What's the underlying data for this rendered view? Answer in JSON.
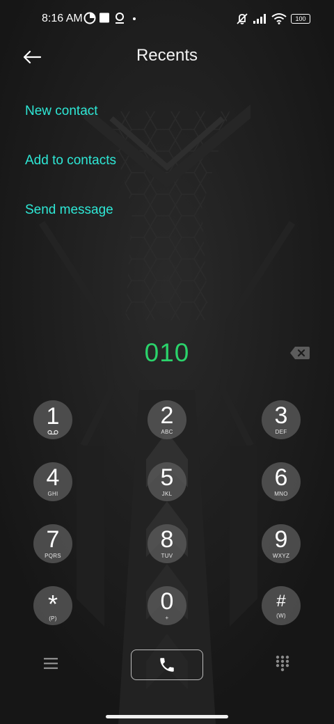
{
  "status_bar": {
    "time": "8:16 AM",
    "battery": "100",
    "left_icons": [
      "data-saver-icon",
      "square-notification-icon",
      "location-pin-icon",
      "dot-icon"
    ],
    "right_icons": [
      "muted-vibrate-icon",
      "signal-icon",
      "wifi-icon",
      "battery-icon"
    ]
  },
  "header": {
    "title": "Recents",
    "back_icon": "arrow-left-icon"
  },
  "actions": [
    {
      "label": "New contact"
    },
    {
      "label": "Add to contacts"
    },
    {
      "label": "Send message"
    }
  ],
  "dialer": {
    "number": "010",
    "backspace_icon": "backspace-icon",
    "keys": [
      {
        "digit": "1",
        "letters": "voicemail"
      },
      {
        "digit": "2",
        "letters": "ABC"
      },
      {
        "digit": "3",
        "letters": "DEF"
      },
      {
        "digit": "4",
        "letters": "GHI"
      },
      {
        "digit": "5",
        "letters": "JKL"
      },
      {
        "digit": "6",
        "letters": "MNO"
      },
      {
        "digit": "7",
        "letters": "PQRS"
      },
      {
        "digit": "8",
        "letters": "TUV"
      },
      {
        "digit": "9",
        "letters": "WXYZ"
      },
      {
        "digit": "*",
        "letters": "(P)"
      },
      {
        "digit": "0",
        "letters": "+"
      },
      {
        "digit": "#",
        "letters": "(W)"
      }
    ]
  },
  "bottom_bar": {
    "menu_icon": "menu-icon",
    "call_icon": "phone-icon",
    "dialpad_icon": "dialpad-icon"
  },
  "colors": {
    "accent_link": "#2ee8d6",
    "number_green": "#2bd36b",
    "background": "#1c1c1c"
  }
}
